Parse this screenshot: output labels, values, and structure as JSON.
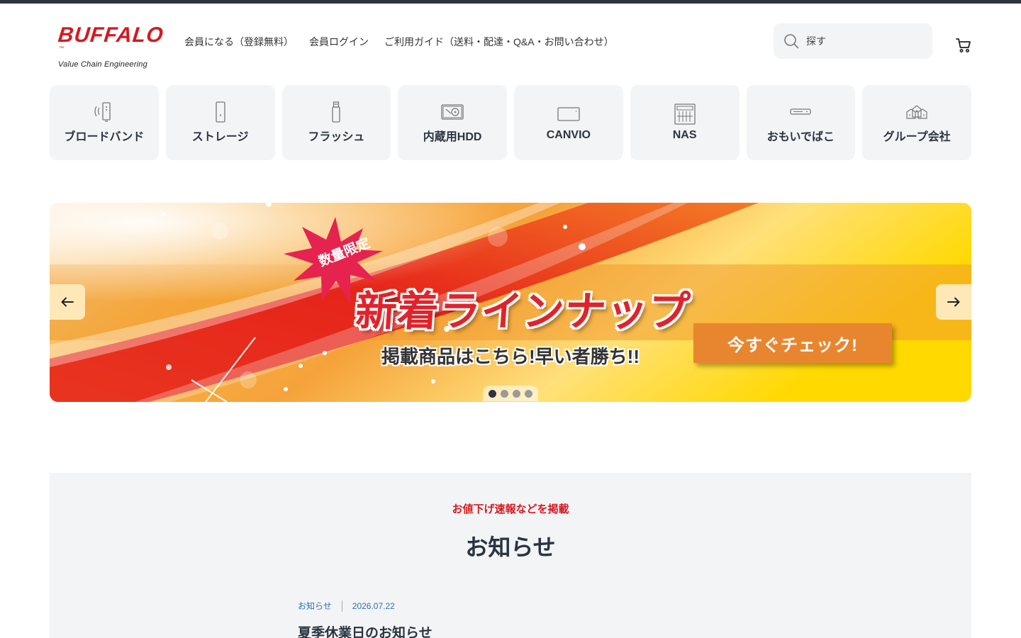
{
  "brand": {
    "logo_text": "BUFFALO",
    "logo_tm": "™",
    "tagline": "Value Chain Engineering",
    "brand_red": "#d7181f"
  },
  "nav": {
    "items": [
      {
        "label": "会員になる（登録無料）"
      },
      {
        "label": "会員ログイン"
      },
      {
        "label": "ご利用ガイド（送料・配達・Q&A・お問い合わせ）"
      }
    ]
  },
  "search": {
    "placeholder": "探す",
    "icon": "search-icon"
  },
  "cart": {
    "icon": "cart-icon"
  },
  "categories": [
    {
      "label": "ブロードバンド",
      "icon": "router-icon"
    },
    {
      "label": "ストレージ",
      "icon": "storage-icon"
    },
    {
      "label": "フラッシュ",
      "icon": "usb-flash-icon"
    },
    {
      "label": "内蔵用HDD",
      "icon": "internal-hdd-icon"
    },
    {
      "label": "CANVIO",
      "icon": "portable-hdd-icon"
    },
    {
      "label": "NAS",
      "icon": "nas-icon"
    },
    {
      "label": "おもいでばこ",
      "icon": "memory-box-icon"
    },
    {
      "label": "グループ会社",
      "icon": "group-company-icon"
    }
  ],
  "banner": {
    "burst_text": "数量限定",
    "headline": "新着ラインナップ",
    "subline": "掲載商品はこちら!早い者勝ち!!",
    "cta": "今すぐチェック!",
    "slide_count": 4,
    "active_slide": 0,
    "accent_red": "#e0232a",
    "accent_orange": "#e8862f",
    "accent_yellow": "#ffd400"
  },
  "news": {
    "kicker": "お値下げ速報などを掲載",
    "title": "お知らせ",
    "items": [
      {
        "category": "お知らせ",
        "date": "2026.07.22",
        "title": "夏季休業日のお知らせ"
      }
    ]
  }
}
